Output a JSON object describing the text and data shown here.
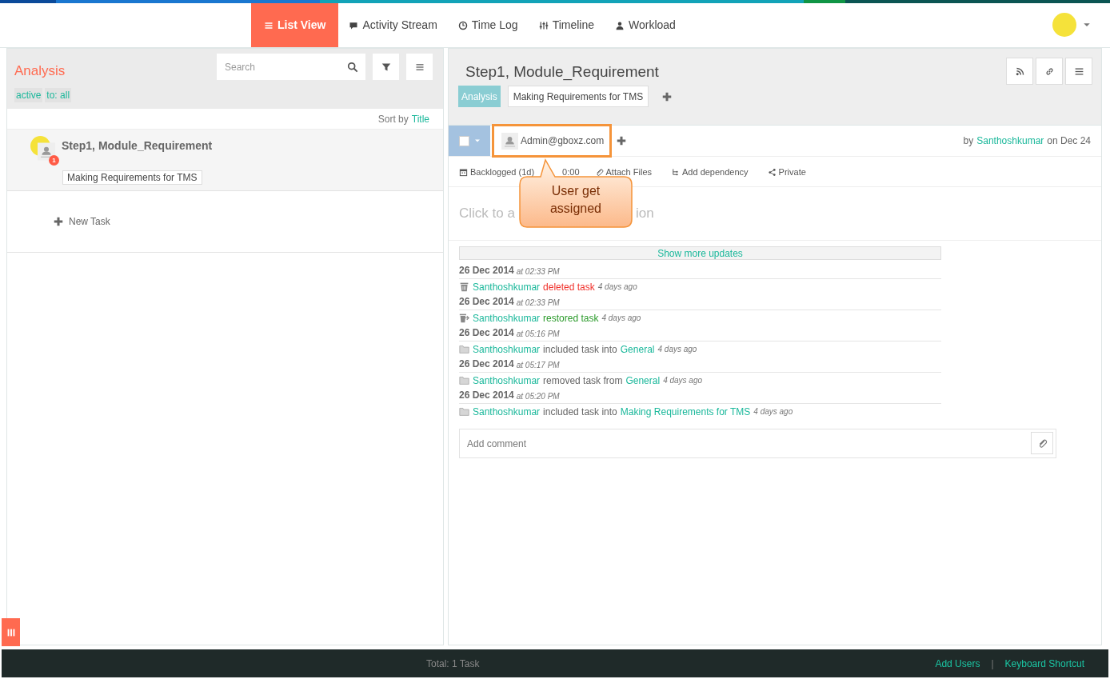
{
  "nav": {
    "tabs": [
      {
        "label": "List View",
        "selected": true
      },
      {
        "label": "Activity Stream",
        "selected": false
      },
      {
        "label": "Time Log",
        "selected": false
      },
      {
        "label": "Timeline",
        "selected": false
      },
      {
        "label": "Workload",
        "selected": false
      }
    ]
  },
  "left": {
    "title": "Analysis",
    "search": {
      "placeholder": "Search"
    },
    "filters": [
      "active",
      "to: all"
    ],
    "sort_label": "Sort by",
    "sort_value": "Title",
    "tasks": [
      {
        "title": "Step1, Module_Requirement",
        "badge": "1",
        "tag": "Making Requirements for TMS"
      }
    ],
    "new_task": "New Task"
  },
  "detail": {
    "title": "Step1, Module_Requirement",
    "tags": [
      {
        "label": "Analysis",
        "kind": "list"
      },
      {
        "label": "Making Requirements for TMS",
        "kind": "project"
      }
    ],
    "checked": false,
    "assignee": "Admin@gboxz.com",
    "by_prefix": "by",
    "by_user": "Santhoshkumar",
    "by_suffix": "on Dec 24",
    "meta": [
      "Backlogged (1d)",
      "0:00",
      "Attach Files",
      "Add dependency",
      "Private"
    ],
    "description_start": "Click to a",
    "description_end": "ion",
    "callout": "User get assigned",
    "show_more": "Show more updates",
    "activity": [
      {
        "date": "26 Dec 2014",
        "time": "at 02:33 PM",
        "kind": "deleted",
        "user": "Santhoshkumar",
        "action": "deleted task",
        "ago": "4 days ago"
      },
      {
        "date": "26 Dec 2014",
        "time": "at 02:33 PM",
        "kind": "restored",
        "user": "Santhoshkumar",
        "action": "restored task",
        "ago": "4 days ago"
      },
      {
        "date": "26 Dec 2014",
        "time": "at 05:16 PM",
        "kind": "moved",
        "user": "Santhoshkumar",
        "action": "included task into",
        "target": "General",
        "ago": "4 days ago"
      },
      {
        "date": "26 Dec 2014",
        "time": "at 05:17 PM",
        "kind": "moved",
        "user": "Santhoshkumar",
        "action": "removed task from",
        "target": "General",
        "ago": "4 days ago"
      },
      {
        "date": "26 Dec 2014",
        "time": "at 05:20 PM",
        "kind": "moved",
        "user": "Santhoshkumar",
        "action": "included task into",
        "target": "Making Requirements for TMS",
        "ago": "4 days ago"
      }
    ],
    "comment": {
      "placeholder": "Add comment"
    }
  },
  "footer": {
    "total": "Total: 1 Task",
    "links": [
      "Add Users",
      "Keyboard Shortcut"
    ],
    "separator": "|"
  }
}
